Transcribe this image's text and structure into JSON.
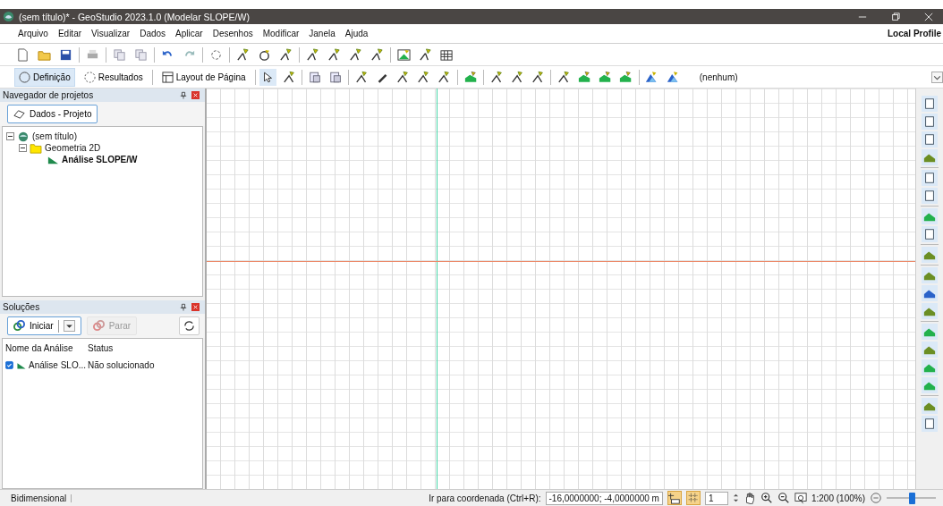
{
  "window": {
    "title": "(sem título)* - GeoStudio 2023.1.0 (Modelar SLOPE/W)"
  },
  "menu": [
    "Arquivo",
    "Editar",
    "Visualizar",
    "Dados",
    "Aplicar",
    "Desenhos",
    "Modificar",
    "Janela",
    "Ajuda"
  ],
  "profile": "Local Profile",
  "mode_tabs": [
    {
      "label": "Definição",
      "selected": true
    },
    {
      "label": "Resultados",
      "selected": false
    }
  ],
  "page_layout_button": "Layout de Página",
  "view_dropdown": {
    "value": "(nenhum)"
  },
  "project_navigator": {
    "title": "Navegador de projetos",
    "data_button": "Dados - Projeto",
    "tree": [
      {
        "label": "(sem título)",
        "kind": "project",
        "expanded": true,
        "selected": false,
        "children": [
          {
            "label": "Geometria 2D",
            "kind": "folder",
            "expanded": true,
            "selected": false,
            "children": [
              {
                "label": "Análise SLOPE/W",
                "kind": "analysis",
                "selected": true
              }
            ]
          }
        ]
      }
    ]
  },
  "solutions": {
    "title": "Soluções",
    "start_button": "Iniciar",
    "stop_button": {
      "label": "Parar",
      "disabled": true
    },
    "columns": [
      "Nome da Análise",
      "Status"
    ],
    "rows": [
      {
        "checked": true,
        "name": "Análise SLO...",
        "status": "Não solucionado"
      }
    ]
  },
  "status_bar": {
    "mode": "Bidimensional",
    "goto_label": "Ir para coordenada (Ctrl+R):",
    "goto_value": "-16,0000000; -4,0000000 m",
    "grid_step": "1",
    "scale": "1:200 (100%)",
    "zoom": {
      "level": 0.5
    }
  }
}
